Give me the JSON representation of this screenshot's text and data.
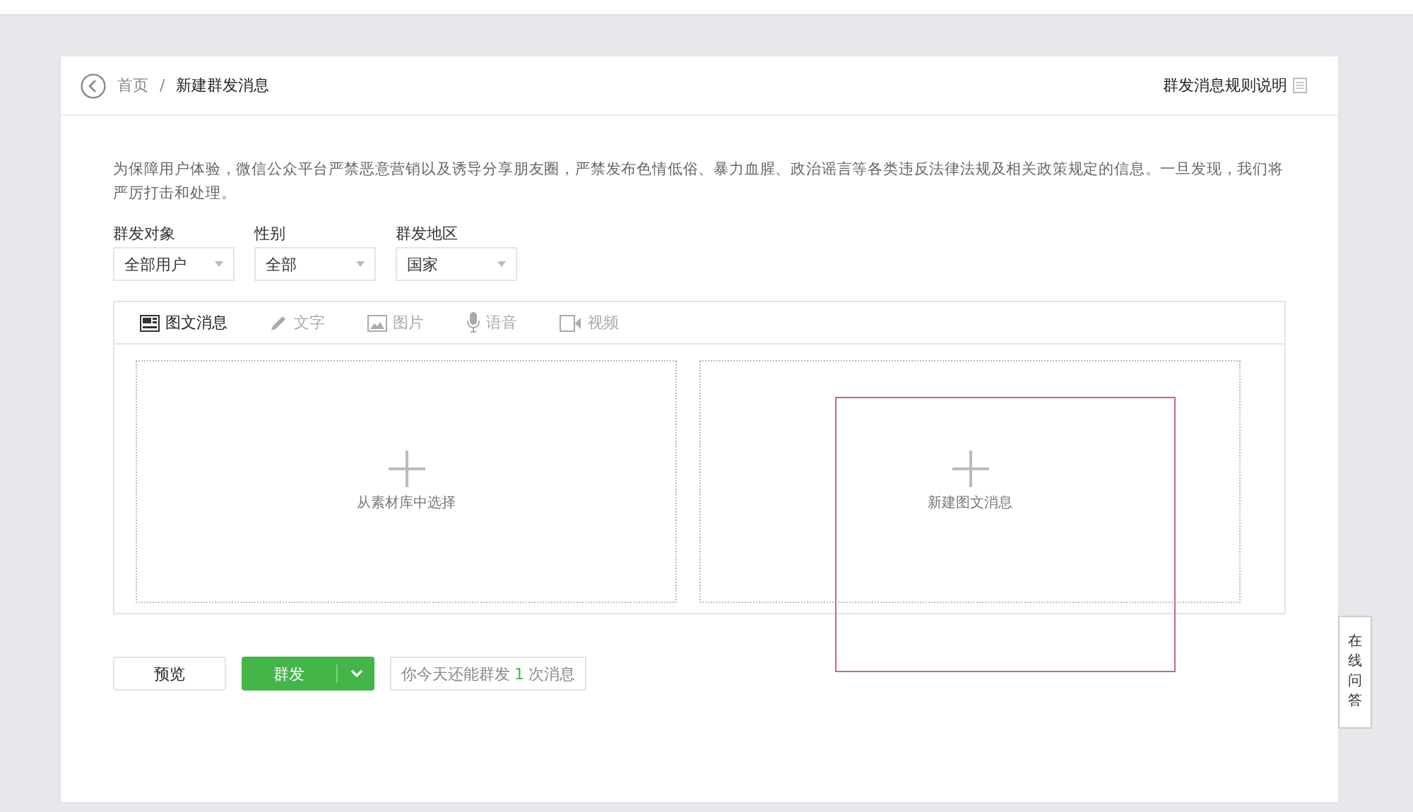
{
  "breadcrumb": {
    "home": "首页",
    "separator": "/",
    "current": "新建群发消息"
  },
  "rules_link": "群发消息规则说明",
  "notice": "为保障用户体验，微信公众平台严禁恶意营销以及诱导分享朋友圈，严禁发布色情低俗、暴力血腥、政治谣言等各类违反法律法规及相关政策规定的信息。一旦发现，我们将严厉打击和处理。",
  "filters": [
    {
      "label": "群发对象",
      "value": "全部用户"
    },
    {
      "label": "性别",
      "value": "全部"
    },
    {
      "label": "群发地区",
      "value": "国家"
    }
  ],
  "tabs": [
    {
      "kind": "article",
      "label": "图文消息",
      "selected": true
    },
    {
      "kind": "text",
      "label": "文字",
      "selected": false
    },
    {
      "kind": "image",
      "label": "图片",
      "selected": false
    },
    {
      "kind": "voice",
      "label": "语音",
      "selected": false
    },
    {
      "kind": "video",
      "label": "视频",
      "selected": false
    }
  ],
  "choices": [
    {
      "label": "从素材库中选择",
      "highlighted": false
    },
    {
      "label": "新建图文消息",
      "highlighted": true
    }
  ],
  "preview_button": "预览",
  "send_button": "群发",
  "quota": {
    "before": "你今天还能群发",
    "count": "1",
    "after": "次消息"
  },
  "side_tab": "在线问答"
}
